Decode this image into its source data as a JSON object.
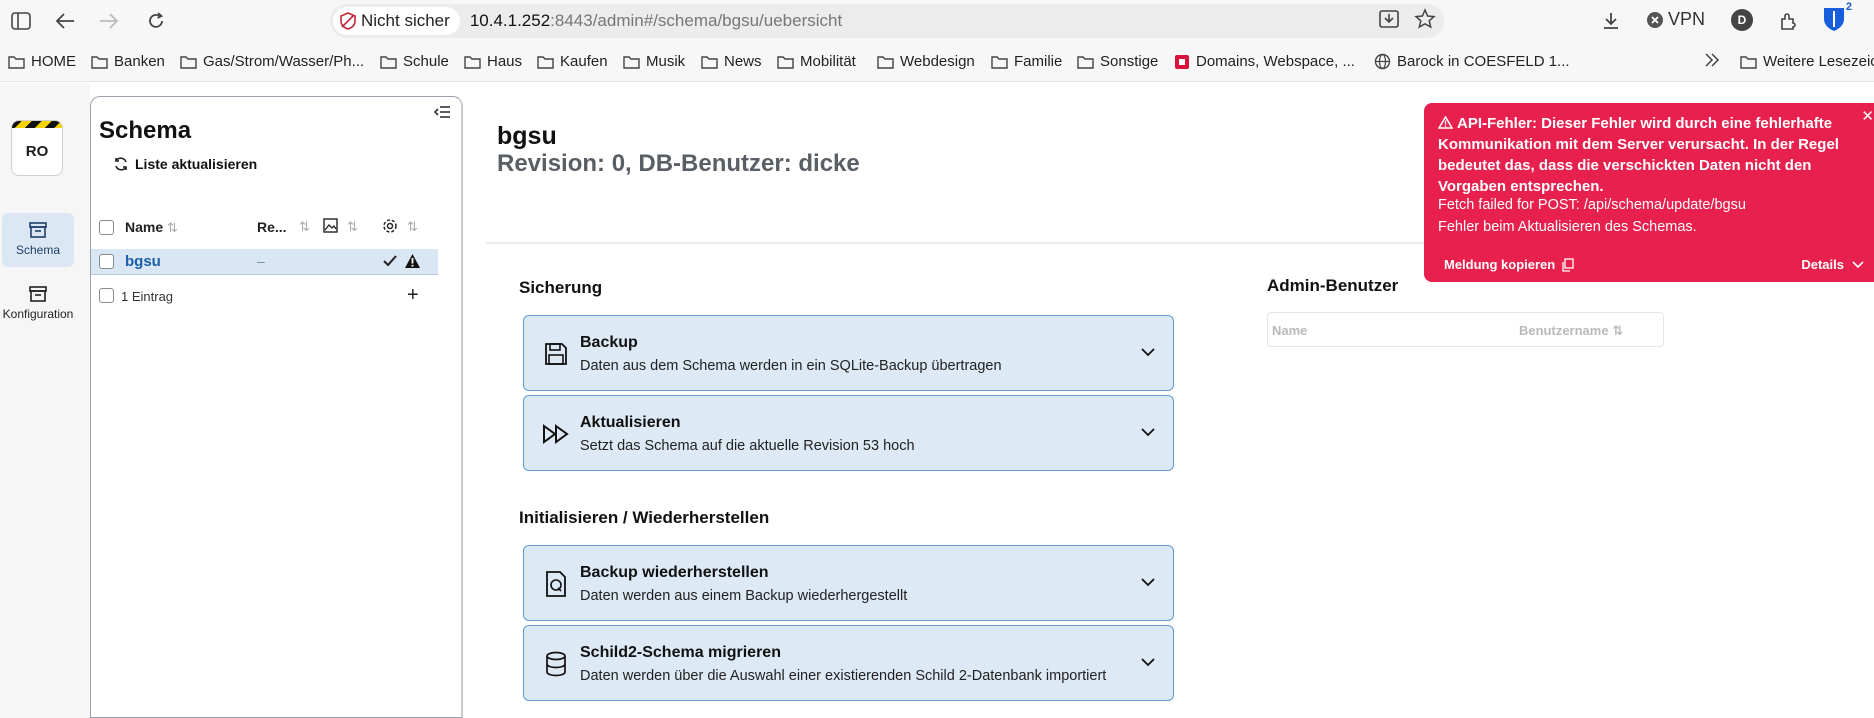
{
  "browser": {
    "security_label": "Nicht sicher",
    "url_host": "10.4.1.252",
    "url_rest": ":8443/admin#/schema/bgsu/uebersicht",
    "vpn_label": "VPN",
    "profile_initial": "D",
    "ext_badge": "2"
  },
  "bookmarks": [
    "HOME",
    "Banken",
    "Gas/Strom/Wasser/Ph...",
    "Schule",
    "Haus",
    "Kaufen",
    "Musik",
    "News",
    "Mobilität",
    "Webdesign",
    "Familie",
    "Sonstige",
    "Domains, Webspace, ...",
    "Barock in COESFELD 1...",
    "Weitere Lesezeic"
  ],
  "nav": {
    "badge": "RO",
    "items": [
      {
        "label": "Schema"
      },
      {
        "label": "Konfiguration"
      }
    ]
  },
  "schema_panel": {
    "title": "Schema",
    "refresh_label": "Liste aktualisieren",
    "columns": {
      "name": "Name",
      "revision": "Re..."
    },
    "rows": [
      {
        "name": "bgsu",
        "revision": "–"
      }
    ],
    "footer": "1 Eintrag"
  },
  "main": {
    "title": "bgsu",
    "subtitle": "Revision: 0, DB-Benutzer: dicke",
    "sections": [
      {
        "heading": "Sicherung",
        "cards": [
          {
            "title": "Backup",
            "desc": "Daten aus dem Schema werden in ein SQLite-Backup übertragen"
          },
          {
            "title": "Aktualisieren",
            "desc": "Setzt das Schema auf die aktuelle Revision 53 hoch"
          }
        ]
      },
      {
        "heading": "Initialisieren / Wiederherstellen",
        "cards": [
          {
            "title": "Backup wiederherstellen",
            "desc": "Daten werden aus einem Backup wiederhergestellt"
          },
          {
            "title": "Schild2-Schema migrieren",
            "desc": "Daten werden über die Auswahl einer existierenden Schild 2-Datenbank importiert"
          }
        ]
      }
    ],
    "admin": {
      "heading": "Admin-Benutzer",
      "col_name": "Name",
      "col_user": "Benutzername"
    }
  },
  "toast": {
    "heading": "API-Fehler: Dieser Fehler wird durch eine fehlerhafte Kommunikation mit dem Server verursacht. In der Regel bedeutet das, dass die verschickten Daten nicht den Vorgaben entsprechen.",
    "line1": "Fetch failed for POST: /api/schema/update/bgsu",
    "line2": "Fehler beim Aktualisieren des Schemas.",
    "copy_label": "Meldung kopieren",
    "details_label": "Details",
    "color": "#e8204e"
  }
}
